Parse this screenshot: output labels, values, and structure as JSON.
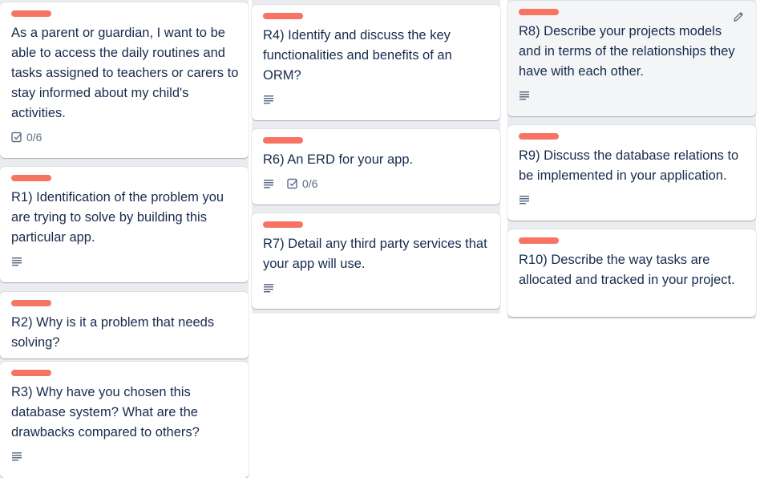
{
  "columns": [
    {
      "cards": [
        {
          "title": "As a parent or guardian, I want to be able to access the daily routines and tasks assigned to teachers or carers to stay informed about my child's activities.",
          "label_color": "#f87462",
          "has_description": false,
          "checklist": "0/6"
        },
        {
          "title": "R1) Identification of the problem you are trying to solve by building this particular app.",
          "label_color": "#f87462",
          "has_description": true
        },
        {
          "title": "R2) Why is it a problem that needs solving?",
          "label_color": "#f87462",
          "has_description": false
        },
        {
          "title": "R3) Why have you chosen this database system? What are the drawbacks compared to others?",
          "label_color": "#f87462",
          "has_description": true
        }
      ]
    },
    {
      "cards": [
        {
          "title": "R4) Identify and discuss the key functionalities and benefits of an ORM?",
          "label_color": "#f87462",
          "has_description": true
        },
        {
          "title": "R6) An ERD for your app.",
          "label_color": "#f87462",
          "has_description": true,
          "checklist": "0/6"
        },
        {
          "title": "R7) Detail any third party services that your app will use.",
          "label_color": "#f87462",
          "has_description": true
        }
      ]
    },
    {
      "cards": [
        {
          "title": "R8) Describe your projects models and in terms of the relationships they have with each other.",
          "label_color": "#f87462",
          "has_description": true,
          "hovered": true
        },
        {
          "title": "R9) Discuss the database relations to be implemented in your application.",
          "label_color": "#f87462",
          "has_description": true
        },
        {
          "title": "R10) Describe the way tasks are allocated and tracked in your project.",
          "label_color": "#f87462",
          "has_description": false
        }
      ]
    }
  ],
  "icons": {
    "description": "description-icon",
    "checklist": "checklist-icon",
    "edit": "pencil-icon"
  }
}
